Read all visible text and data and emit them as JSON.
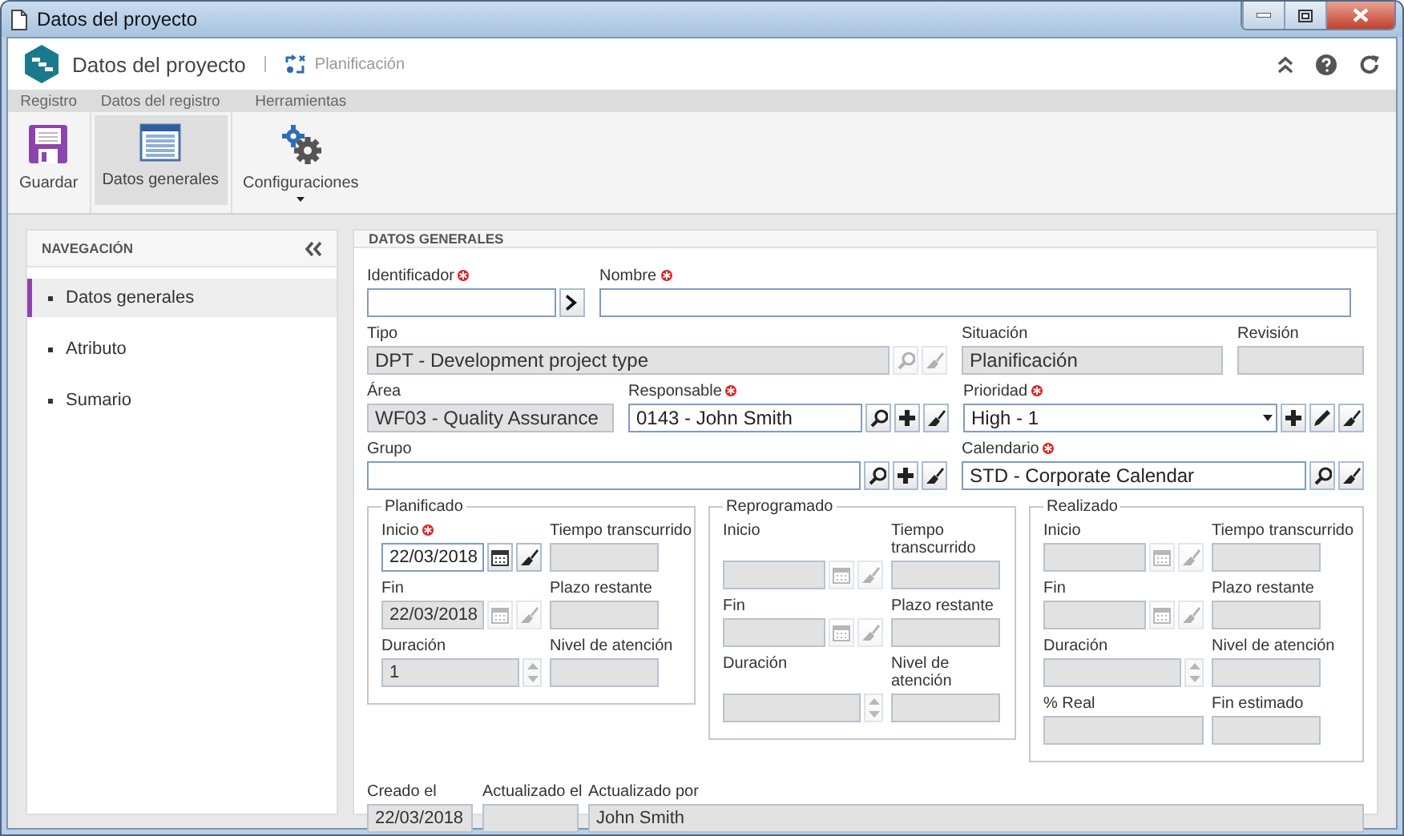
{
  "window": {
    "title": "Datos del proyecto"
  },
  "header": {
    "title": "Datos del proyecto",
    "breadcrumb": "Planificación"
  },
  "ribbon": {
    "groups": [
      {
        "label": "Registro",
        "buttons": [
          {
            "label": "Guardar",
            "selected": false,
            "dropdown": false
          }
        ]
      },
      {
        "label": "Datos del registro",
        "buttons": [
          {
            "label": "Datos generales",
            "selected": true,
            "dropdown": false
          }
        ]
      },
      {
        "label": "Herramientas",
        "buttons": [
          {
            "label": "Configuraciones",
            "selected": false,
            "dropdown": true
          }
        ]
      }
    ]
  },
  "navigation": {
    "title": "NAVEGACIÓN",
    "items": [
      {
        "label": "Datos generales",
        "selected": true
      },
      {
        "label": "Atributo",
        "selected": false
      },
      {
        "label": "Sumario",
        "selected": false
      }
    ]
  },
  "form": {
    "title": "DATOS GENERALES",
    "fields": [
      {
        "label": "Identificador",
        "required": true,
        "disabled": false,
        "kind": "text",
        "buttons": [
          {
            "kind": "go",
            "disabled": false
          }
        ]
      },
      {
        "label": "Nombre",
        "required": true,
        "disabled": false,
        "kind": "text"
      },
      {
        "label": "Tipo",
        "required": false,
        "disabled": true,
        "kind": "text",
        "value": "DPT - Development project type",
        "buttons": [
          {
            "kind": "search",
            "disabled": true
          },
          {
            "kind": "clear",
            "disabled": true
          }
        ]
      },
      {
        "label": "Situación",
        "required": false,
        "disabled": true,
        "kind": "text",
        "value": "Planificación"
      },
      {
        "label": "Revisión",
        "required": false,
        "disabled": true,
        "kind": "text"
      },
      {
        "label": "Área",
        "required": false,
        "disabled": true,
        "kind": "text",
        "value": "WF03 - Quality Assurance"
      },
      {
        "label": "Responsable",
        "required": true,
        "disabled": false,
        "kind": "text",
        "value": "0143 - John Smith",
        "buttons": [
          {
            "kind": "search",
            "disabled": false
          },
          {
            "kind": "add",
            "disabled": false
          },
          {
            "kind": "clear",
            "disabled": false
          }
        ]
      },
      {
        "label": "Prioridad",
        "required": true,
        "disabled": false,
        "kind": "select",
        "value": "High - 1",
        "buttons": [
          {
            "kind": "add",
            "disabled": false
          },
          {
            "kind": "edit",
            "disabled": false
          },
          {
            "kind": "clear",
            "disabled": false
          }
        ]
      },
      {
        "label": "Grupo",
        "required": false,
        "disabled": false,
        "kind": "text",
        "buttons": [
          {
            "kind": "search",
            "disabled": false
          },
          {
            "kind": "add",
            "disabled": false
          },
          {
            "kind": "clear",
            "disabled": false
          }
        ]
      },
      {
        "label": "Calendario",
        "required": true,
        "disabled": false,
        "kind": "text",
        "value": "STD - Corporate Calendar",
        "buttons": [
          {
            "kind": "search",
            "disabled": false
          },
          {
            "kind": "clear",
            "disabled": false
          }
        ]
      }
    ],
    "groups": [
      {
        "title": "Planificado",
        "fields": [
          {
            "label": "Inicio",
            "required": true,
            "disabled": false,
            "kind": "text",
            "value": "22/03/2018",
            "buttons": [
              {
                "kind": "calendar",
                "disabled": false
              },
              {
                "kind": "clear",
                "disabled": false
              }
            ]
          },
          {
            "label": "Tiempo transcurrido",
            "required": false,
            "disabled": true,
            "kind": "text"
          },
          {
            "label": "Fin",
            "required": false,
            "disabled": true,
            "kind": "text",
            "value": "22/03/2018",
            "buttons": [
              {
                "kind": "calendar",
                "disabled": true
              },
              {
                "kind": "clear",
                "disabled": true
              }
            ]
          },
          {
            "label": "Plazo restante",
            "required": false,
            "disabled": true,
            "kind": "text"
          },
          {
            "label": "Duración",
            "required": false,
            "disabled": true,
            "kind": "spinner",
            "value": "1"
          },
          {
            "label": "Nivel de atención",
            "required": false,
            "disabled": true,
            "kind": "text"
          }
        ]
      },
      {
        "title": "Reprogramado",
        "fields": [
          {
            "label": "Inicio",
            "required": false,
            "disabled": true,
            "kind": "text",
            "buttons": [
              {
                "kind": "calendar",
                "disabled": true
              },
              {
                "kind": "clear",
                "disabled": true
              }
            ]
          },
          {
            "label": "Tiempo transcurrido",
            "required": false,
            "disabled": true,
            "kind": "text"
          },
          {
            "label": "Fin",
            "required": false,
            "disabled": true,
            "kind": "text",
            "buttons": [
              {
                "kind": "calendar",
                "disabled": true
              },
              {
                "kind": "clear",
                "disabled": true
              }
            ]
          },
          {
            "label": "Plazo restante",
            "required": false,
            "disabled": true,
            "kind": "text"
          },
          {
            "label": "Duración",
            "required": false,
            "disabled": true,
            "kind": "spinner"
          },
          {
            "label": "Nivel de atención",
            "required": false,
            "disabled": true,
            "kind": "text"
          }
        ]
      },
      {
        "title": "Realizado",
        "fields": [
          {
            "label": "Inicio",
            "required": false,
            "disabled": true,
            "kind": "text",
            "buttons": [
              {
                "kind": "calendar",
                "disabled": true
              },
              {
                "kind": "clear",
                "disabled": true
              }
            ]
          },
          {
            "label": "Tiempo transcurrido",
            "required": false,
            "disabled": true,
            "kind": "text"
          },
          {
            "label": "Fin",
            "required": false,
            "disabled": true,
            "kind": "text",
            "buttons": [
              {
                "kind": "calendar",
                "disabled": true
              },
              {
                "kind": "clear",
                "disabled": true
              }
            ]
          },
          {
            "label": "Plazo restante",
            "required": false,
            "disabled": true,
            "kind": "text"
          },
          {
            "label": "Duración",
            "required": false,
            "disabled": true,
            "kind": "spinner"
          },
          {
            "label": "Nivel de atención",
            "required": false,
            "disabled": true,
            "kind": "text"
          },
          {
            "label": "% Real",
            "required": false,
            "disabled": true,
            "kind": "text"
          },
          {
            "label": "Fin estimado",
            "required": false,
            "disabled": true,
            "kind": "text"
          }
        ]
      }
    ],
    "footer": [
      {
        "label": "Creado el",
        "required": false,
        "disabled": true,
        "value": "22/03/2018"
      },
      {
        "label": "Actualizado el",
        "required": false,
        "disabled": true
      },
      {
        "label": "Actualizado por",
        "required": false,
        "disabled": true,
        "value": "John Smith"
      }
    ]
  }
}
